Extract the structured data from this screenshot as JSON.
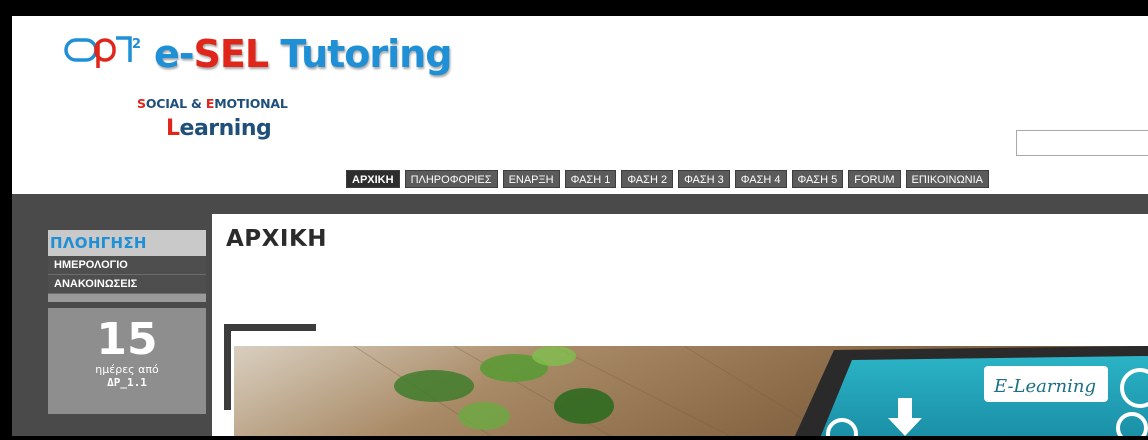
{
  "logo": {
    "mark_sup": "2",
    "title_e": "e-",
    "title_sel": "SEL",
    "title_tutoring": " Tutoring",
    "sub_s": "S",
    "sub_ocial": "OCIAL & ",
    "sub_e": "E",
    "sub_motional": "MOTIONAL",
    "learn_l": "L",
    "learn_rest": "earning"
  },
  "search": {
    "placeholder": ""
  },
  "nav": {
    "items": [
      "ΑΡΧΙΚΗ",
      "ΠΛΗΡΟΦΟΡΙΕΣ",
      "ΕΝΑΡΞΗ",
      "ΦΑΣΗ 1",
      "ΦΑΣΗ 2",
      "ΦΑΣΗ 3",
      "ΦΑΣΗ 4",
      "ΦΑΣΗ 5",
      "FORUM",
      "ΕΠΙΚΟΙΝΩΝΙΑ"
    ],
    "active_index": 0
  },
  "sidebar": {
    "heading": "ΠΛΟΗΓΗΣΗ",
    "items": [
      "ΗΜΕΡΟΛΟΓΙΟ",
      "ΑΝΑΚΟΙΝΩΣΕΙΣ"
    ]
  },
  "counter": {
    "number": "15",
    "label": "ημέρες από",
    "label2": "ΔΡ_1.1"
  },
  "main": {
    "title": "ΑΡΧΙΚΗ"
  },
  "hero": {
    "caption": "E-Learning"
  },
  "colors": {
    "brand_blue": "#1f8fd6",
    "brand_red": "#e0261b",
    "dark_nav": "#5b5b5b",
    "sidebar_bg": "#4a4a4a"
  }
}
